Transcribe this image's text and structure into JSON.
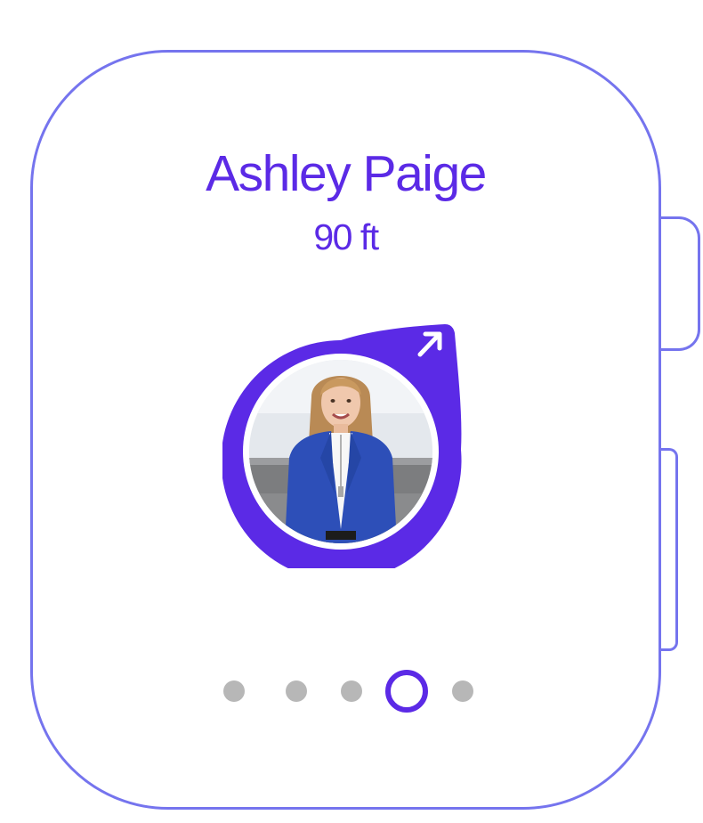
{
  "contact": {
    "name": "Ashley Paige",
    "distance": "90 ft"
  },
  "icons": {
    "direction": "arrow-up-right-icon",
    "avatar": "person-photo"
  },
  "pagination": {
    "total": 5,
    "active_index": 3
  },
  "colors": {
    "accent": "#5b2ae6",
    "outline": "#7574ee",
    "inactive_dot": "#b7b7b7",
    "jacket": "#2d4fb8"
  }
}
